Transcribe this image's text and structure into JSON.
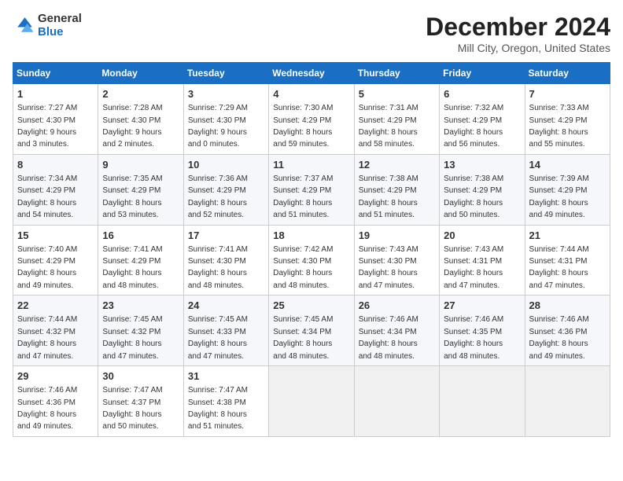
{
  "logo": {
    "general": "General",
    "blue": "Blue"
  },
  "header": {
    "title": "December 2024",
    "subtitle": "Mill City, Oregon, United States"
  },
  "weekdays": [
    "Sunday",
    "Monday",
    "Tuesday",
    "Wednesday",
    "Thursday",
    "Friday",
    "Saturday"
  ],
  "weeks": [
    [
      {
        "day": "1",
        "info": "Sunrise: 7:27 AM\nSunset: 4:30 PM\nDaylight: 9 hours\nand 3 minutes."
      },
      {
        "day": "2",
        "info": "Sunrise: 7:28 AM\nSunset: 4:30 PM\nDaylight: 9 hours\nand 2 minutes."
      },
      {
        "day": "3",
        "info": "Sunrise: 7:29 AM\nSunset: 4:30 PM\nDaylight: 9 hours\nand 0 minutes."
      },
      {
        "day": "4",
        "info": "Sunrise: 7:30 AM\nSunset: 4:29 PM\nDaylight: 8 hours\nand 59 minutes."
      },
      {
        "day": "5",
        "info": "Sunrise: 7:31 AM\nSunset: 4:29 PM\nDaylight: 8 hours\nand 58 minutes."
      },
      {
        "day": "6",
        "info": "Sunrise: 7:32 AM\nSunset: 4:29 PM\nDaylight: 8 hours\nand 56 minutes."
      },
      {
        "day": "7",
        "info": "Sunrise: 7:33 AM\nSunset: 4:29 PM\nDaylight: 8 hours\nand 55 minutes."
      }
    ],
    [
      {
        "day": "8",
        "info": "Sunrise: 7:34 AM\nSunset: 4:29 PM\nDaylight: 8 hours\nand 54 minutes."
      },
      {
        "day": "9",
        "info": "Sunrise: 7:35 AM\nSunset: 4:29 PM\nDaylight: 8 hours\nand 53 minutes."
      },
      {
        "day": "10",
        "info": "Sunrise: 7:36 AM\nSunset: 4:29 PM\nDaylight: 8 hours\nand 52 minutes."
      },
      {
        "day": "11",
        "info": "Sunrise: 7:37 AM\nSunset: 4:29 PM\nDaylight: 8 hours\nand 51 minutes."
      },
      {
        "day": "12",
        "info": "Sunrise: 7:38 AM\nSunset: 4:29 PM\nDaylight: 8 hours\nand 51 minutes."
      },
      {
        "day": "13",
        "info": "Sunrise: 7:38 AM\nSunset: 4:29 PM\nDaylight: 8 hours\nand 50 minutes."
      },
      {
        "day": "14",
        "info": "Sunrise: 7:39 AM\nSunset: 4:29 PM\nDaylight: 8 hours\nand 49 minutes."
      }
    ],
    [
      {
        "day": "15",
        "info": "Sunrise: 7:40 AM\nSunset: 4:29 PM\nDaylight: 8 hours\nand 49 minutes."
      },
      {
        "day": "16",
        "info": "Sunrise: 7:41 AM\nSunset: 4:29 PM\nDaylight: 8 hours\nand 48 minutes."
      },
      {
        "day": "17",
        "info": "Sunrise: 7:41 AM\nSunset: 4:30 PM\nDaylight: 8 hours\nand 48 minutes."
      },
      {
        "day": "18",
        "info": "Sunrise: 7:42 AM\nSunset: 4:30 PM\nDaylight: 8 hours\nand 48 minutes."
      },
      {
        "day": "19",
        "info": "Sunrise: 7:43 AM\nSunset: 4:30 PM\nDaylight: 8 hours\nand 47 minutes."
      },
      {
        "day": "20",
        "info": "Sunrise: 7:43 AM\nSunset: 4:31 PM\nDaylight: 8 hours\nand 47 minutes."
      },
      {
        "day": "21",
        "info": "Sunrise: 7:44 AM\nSunset: 4:31 PM\nDaylight: 8 hours\nand 47 minutes."
      }
    ],
    [
      {
        "day": "22",
        "info": "Sunrise: 7:44 AM\nSunset: 4:32 PM\nDaylight: 8 hours\nand 47 minutes."
      },
      {
        "day": "23",
        "info": "Sunrise: 7:45 AM\nSunset: 4:32 PM\nDaylight: 8 hours\nand 47 minutes."
      },
      {
        "day": "24",
        "info": "Sunrise: 7:45 AM\nSunset: 4:33 PM\nDaylight: 8 hours\nand 47 minutes."
      },
      {
        "day": "25",
        "info": "Sunrise: 7:45 AM\nSunset: 4:34 PM\nDaylight: 8 hours\nand 48 minutes."
      },
      {
        "day": "26",
        "info": "Sunrise: 7:46 AM\nSunset: 4:34 PM\nDaylight: 8 hours\nand 48 minutes."
      },
      {
        "day": "27",
        "info": "Sunrise: 7:46 AM\nSunset: 4:35 PM\nDaylight: 8 hours\nand 48 minutes."
      },
      {
        "day": "28",
        "info": "Sunrise: 7:46 AM\nSunset: 4:36 PM\nDaylight: 8 hours\nand 49 minutes."
      }
    ],
    [
      {
        "day": "29",
        "info": "Sunrise: 7:46 AM\nSunset: 4:36 PM\nDaylight: 8 hours\nand 49 minutes."
      },
      {
        "day": "30",
        "info": "Sunrise: 7:47 AM\nSunset: 4:37 PM\nDaylight: 8 hours\nand 50 minutes."
      },
      {
        "day": "31",
        "info": "Sunrise: 7:47 AM\nSunset: 4:38 PM\nDaylight: 8 hours\nand 51 minutes."
      },
      null,
      null,
      null,
      null
    ]
  ]
}
